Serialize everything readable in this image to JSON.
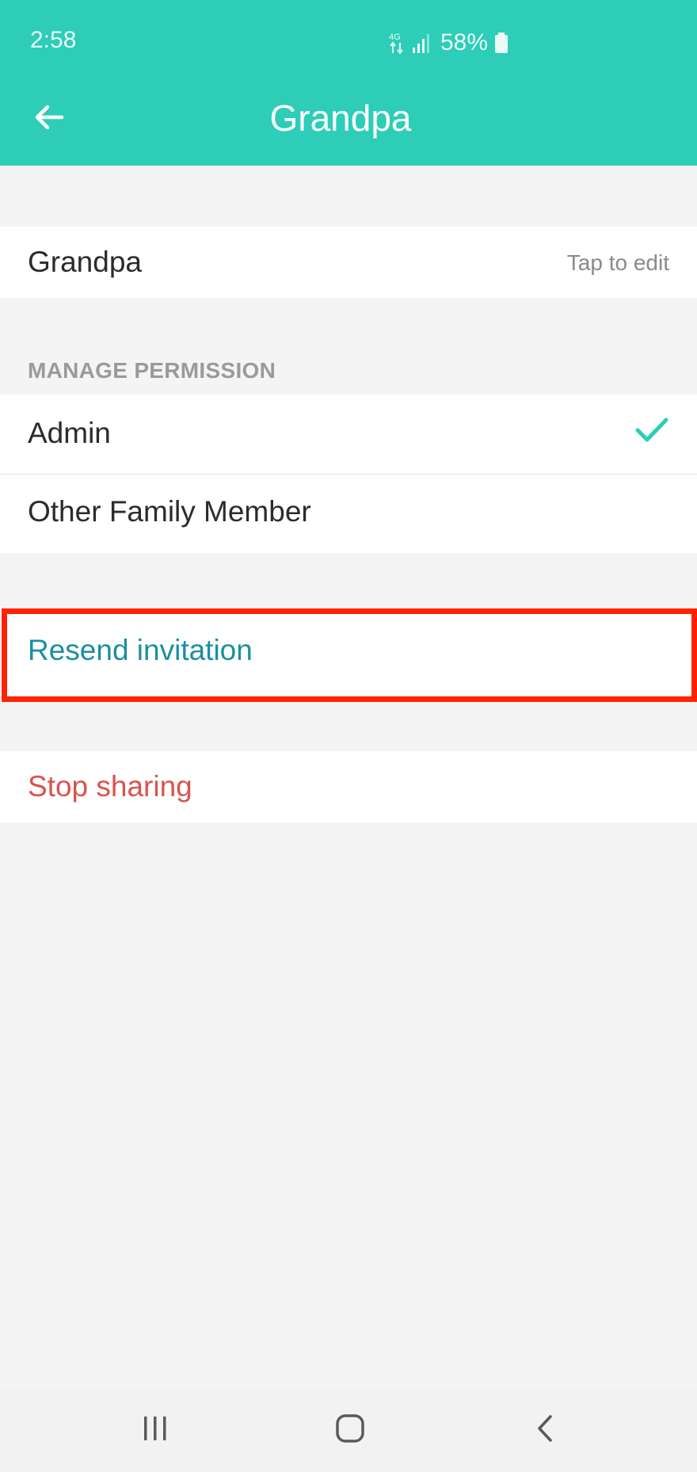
{
  "status_bar": {
    "time": "2:58",
    "network": "4G",
    "battery_percent": "58%",
    "icons": [
      "data-arrows-icon",
      "signal-icon",
      "battery-icon"
    ]
  },
  "app_bar": {
    "title": "Grandpa",
    "back_icon": "arrow-left-icon",
    "background_color": "#2dcdb7"
  },
  "name_row": {
    "name": "Grandpa",
    "hint": "Tap to edit"
  },
  "permissions": {
    "header": "MANAGE PERMISSION",
    "options": [
      {
        "label": "Admin",
        "selected": true
      },
      {
        "label": "Other Family Member",
        "selected": false
      }
    ],
    "check_color": "#2dcdb7"
  },
  "actions": {
    "resend_label": "Resend invitation",
    "resend_color": "#1a8fa3",
    "stop_label": "Stop sharing",
    "stop_color": "#d9534f"
  },
  "highlight": {
    "color": "#ff2200",
    "target": "resend-invitation-button"
  },
  "nav_bar": {
    "icons": [
      "recent-apps-icon",
      "home-icon",
      "back-icon"
    ]
  }
}
